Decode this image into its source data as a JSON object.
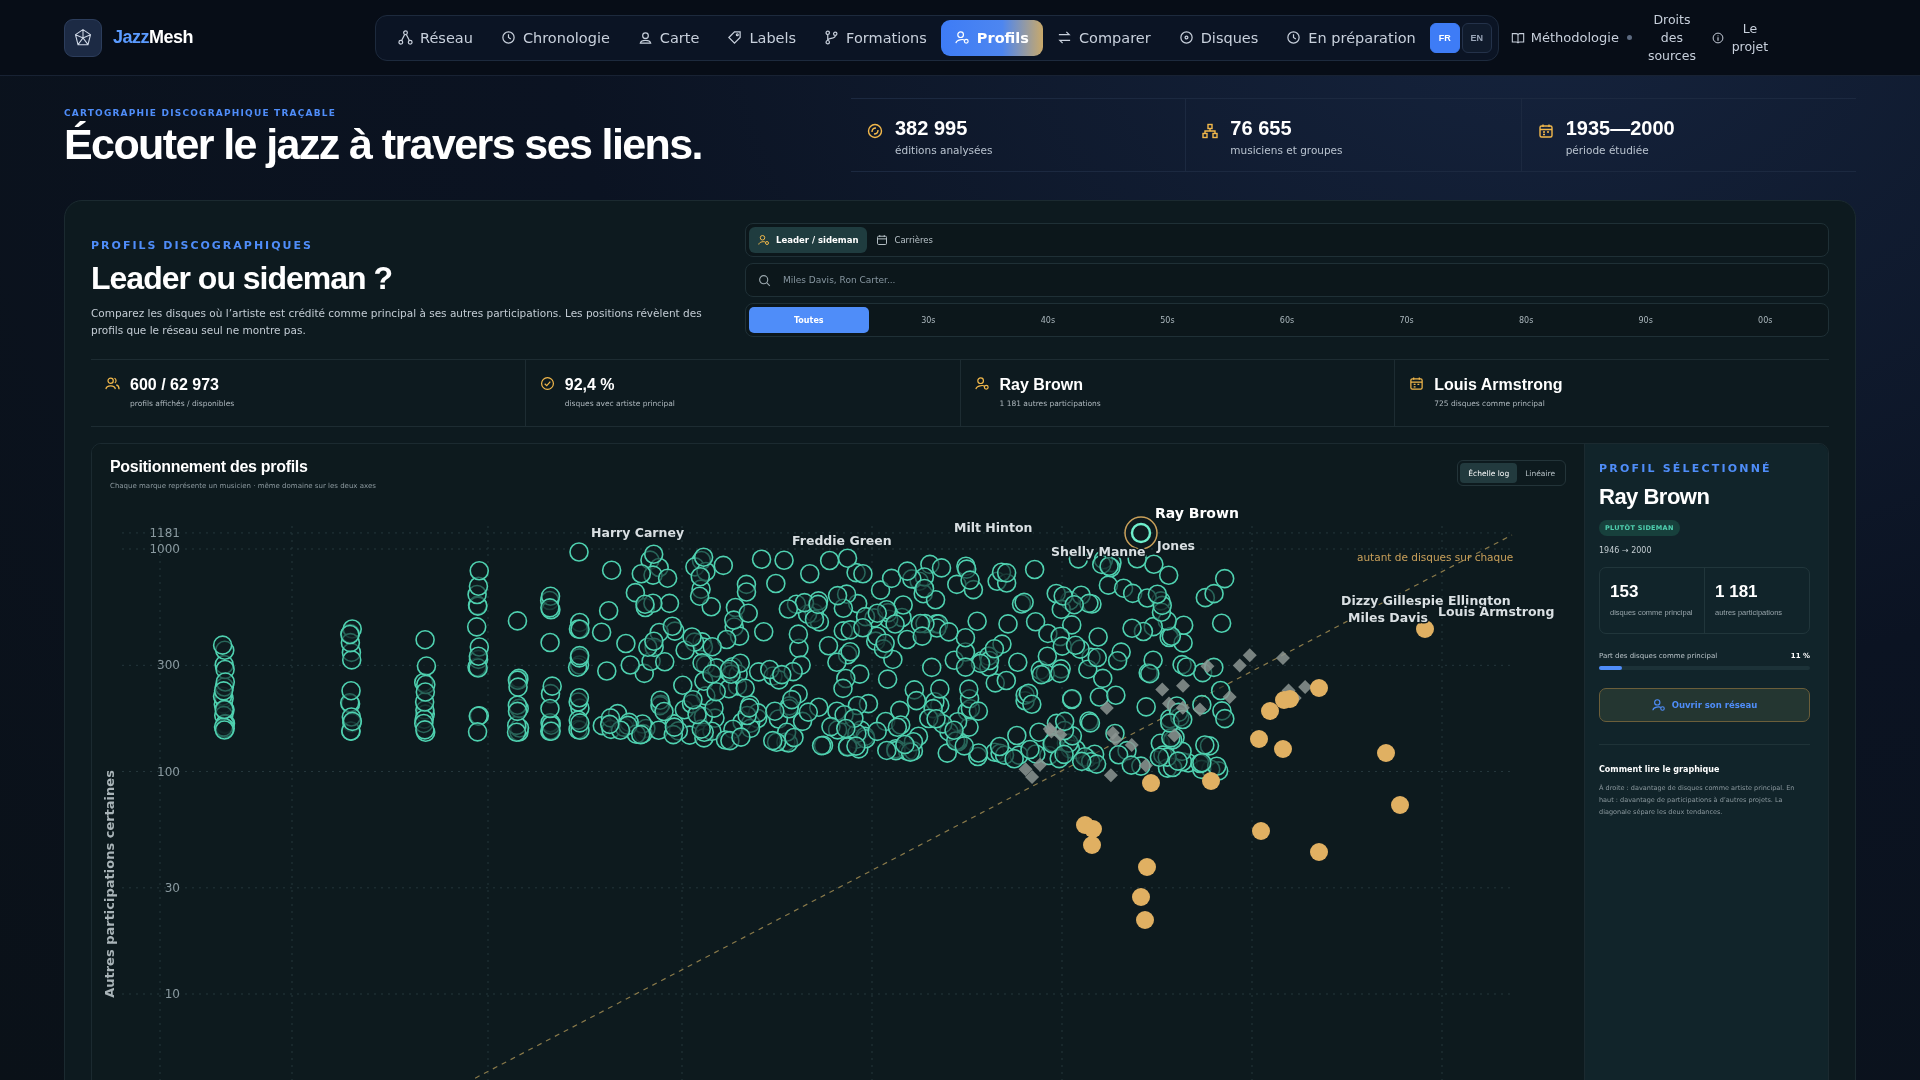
{
  "brand": {
    "first": "Jazz",
    "second": "Mesh"
  },
  "nav": [
    {
      "label": "Réseau",
      "selected": false
    },
    {
      "label": "Chronologie",
      "selected": false
    },
    {
      "label": "Carte",
      "selected": false
    },
    {
      "label": "Labels",
      "selected": false
    },
    {
      "label": "Formations",
      "selected": false
    },
    {
      "label": "Profils",
      "selected": true
    },
    {
      "label": "Comparer",
      "selected": false
    },
    {
      "label": "Disques",
      "selected": false
    },
    {
      "label": "En préparation",
      "selected": false
    }
  ],
  "languages": [
    {
      "label": "FR",
      "selected": true
    },
    {
      "label": "EN",
      "selected": false
    }
  ],
  "links": [
    "Méthodologie",
    "Droits des sources",
    "Le projet"
  ],
  "header": {
    "eyebrow": "CARTOGRAPHIE DISCOGRAPHIQUE TRAÇABLE",
    "title": "Écouter le jazz à travers ses liens.",
    "stats": [
      {
        "value": "382 995",
        "label": "éditions analysées"
      },
      {
        "value": "76 655",
        "label": "musiciens et groupes"
      },
      {
        "value": "1935—2000",
        "label": "période étudiée"
      }
    ]
  },
  "panel": {
    "eyebrow": "PROFILS DISCOGRAPHIQUES",
    "title": "Leader ou sideman ?",
    "description": "Comparez les disques où l’artiste est crédité comme principal à ses autres participations. Les positions révèlent des profils que le réseau seul ne montre pas.",
    "view_tabs": [
      {
        "label": "Leader / sideman",
        "selected": true
      },
      {
        "label": "Carrières",
        "selected": false
      }
    ],
    "search": {
      "placeholder": "Miles Davis, Ron Carter..."
    },
    "decades": [
      {
        "label": "Toutes",
        "selected": true
      },
      {
        "label": "30s",
        "selected": false
      },
      {
        "label": "40s",
        "selected": false
      },
      {
        "label": "50s",
        "selected": false
      },
      {
        "label": "60s",
        "selected": false
      },
      {
        "label": "70s",
        "selected": false
      },
      {
        "label": "80s",
        "selected": false
      },
      {
        "label": "90s",
        "selected": false
      },
      {
        "label": "00s",
        "selected": false
      }
    ],
    "stats": [
      {
        "value": "600 / 62 973",
        "label": "profils affichés / disponibles"
      },
      {
        "value": "92,4 %",
        "label": "disques avec artiste principal"
      },
      {
        "value": "Ray Brown",
        "label": "1 181 autres participations"
      },
      {
        "value": "Louis Armstrong",
        "label": "725 disques comme principal"
      }
    ]
  },
  "chart": {
    "title": "Positionnement des profils",
    "subtitle": "Chaque marque représente un musicien · même domaine sur les deux axes",
    "scale_toggle": [
      {
        "label": "Échelle log",
        "selected": true
      },
      {
        "label": "Linéaire",
        "selected": false
      }
    ],
    "y_ticks": [
      "1181",
      "1000",
      "300",
      "100",
      "30",
      "10"
    ],
    "y_label": "Autres participations certaines",
    "point_labels": [
      "Harry Carney",
      "Freddie Green",
      "Milt Hinton",
      "Ray Brown",
      "Shelly Manne",
      "Jones",
      "Dizzy Gillespie",
      "Ellington",
      "Miles Davis",
      "Louis Armstrong"
    ],
    "diagonal_note": "autant de disques sur chaque"
  },
  "profile": {
    "eyebrow": "PROFIL SÉLECTIONNÉ",
    "name": "Ray Brown",
    "badge": "PLUTÔT SIDEMAN",
    "years": "1946 → 2000",
    "stats": [
      {
        "value": "153",
        "label": "disques comme principal"
      },
      {
        "value": "1 181",
        "label": "autres participations"
      }
    ],
    "share_label": "Part des disques comme principal",
    "share_value": "11 %",
    "level": 0.11,
    "button": "Ouvrir son réseau",
    "help_title": "Comment lire le graphique",
    "help_text": "À droite : davantage de disques comme artiste principal. En haut : davantage de participations à d’autres projets. La diagonale sépare les deux tendances."
  }
}
